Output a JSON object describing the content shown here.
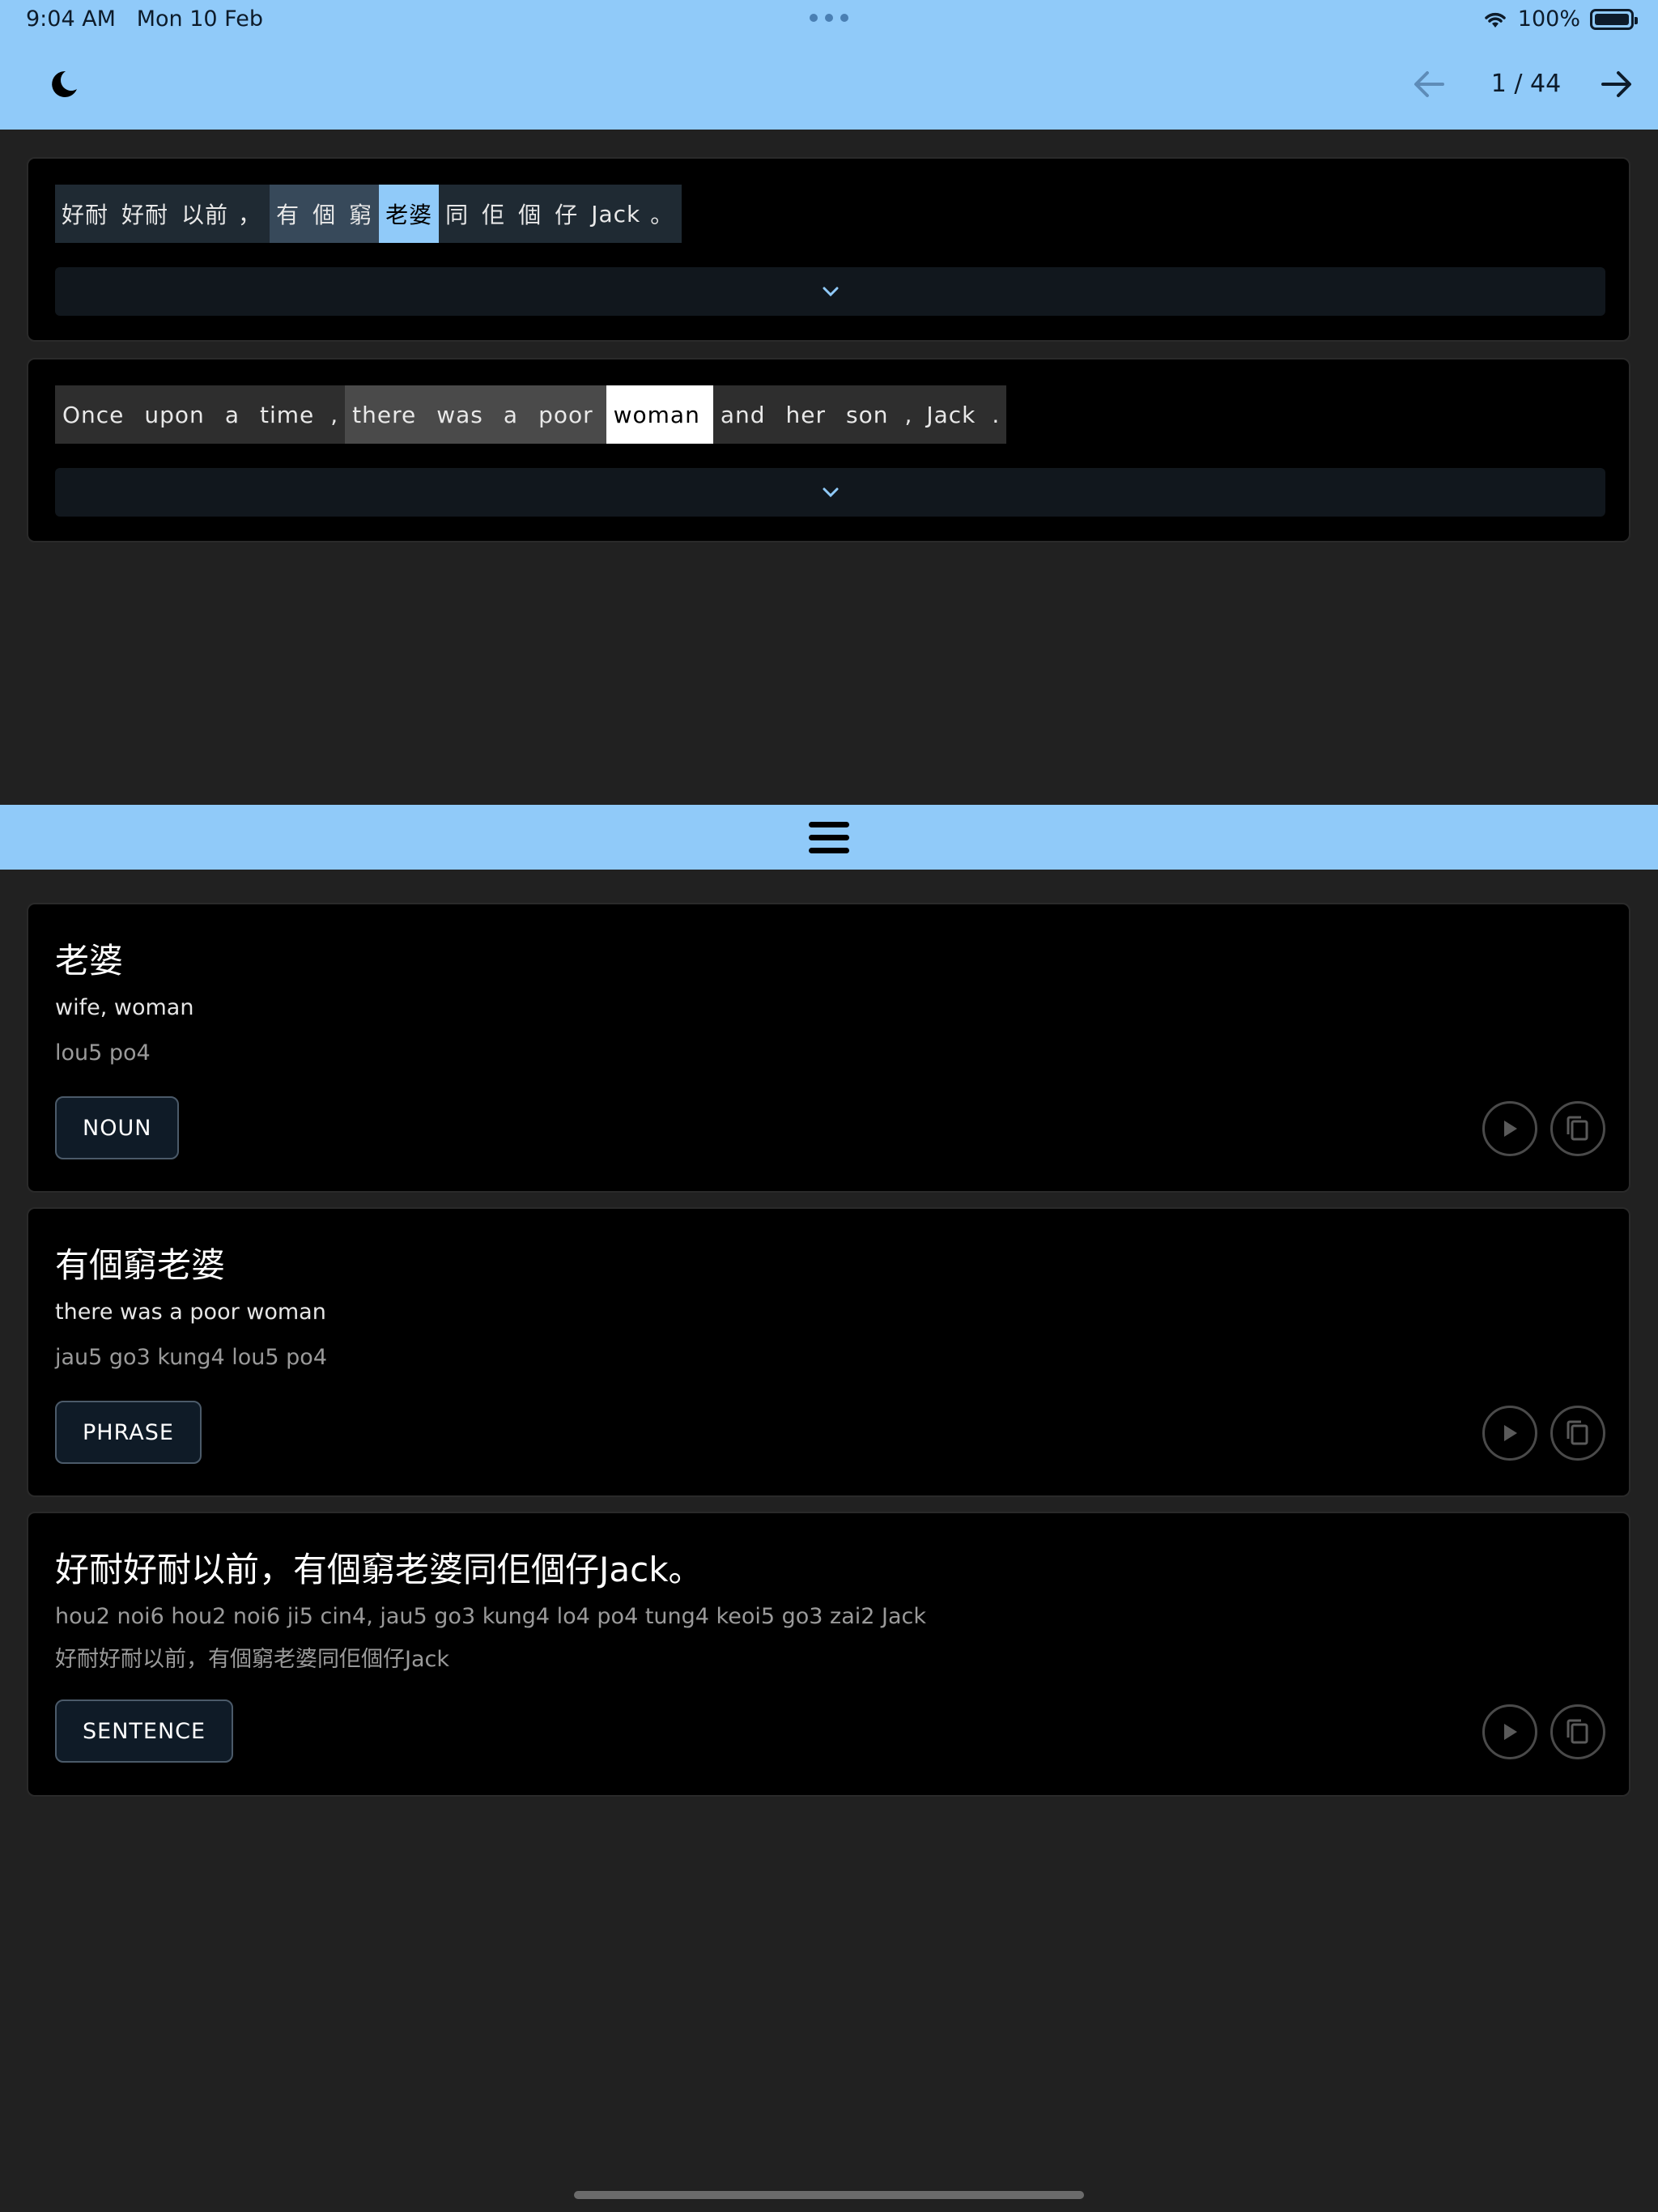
{
  "status_bar": {
    "time": "9:04 AM",
    "date": "Mon 10 Feb",
    "battery": "100%"
  },
  "app_bar": {
    "theme_icon": "moon-icon",
    "page_counter": "1 / 44",
    "prev_icon": "arrow-left-icon",
    "next_icon": "arrow-right-icon"
  },
  "chinese_sentence": {
    "tokens": [
      {
        "text": "好耐",
        "state": "group"
      },
      {
        "text": "好耐",
        "state": "group"
      },
      {
        "text": "以前",
        "state": "group"
      },
      {
        "text": "，",
        "state": "group"
      },
      {
        "text": "有",
        "state": "phrase"
      },
      {
        "text": "個",
        "state": "phrase"
      },
      {
        "text": "窮",
        "state": "phrase"
      },
      {
        "text": "老婆",
        "state": "selected"
      },
      {
        "text": "同",
        "state": "group"
      },
      {
        "text": "佢",
        "state": "group"
      },
      {
        "text": "個",
        "state": "group"
      },
      {
        "text": "仔",
        "state": "group"
      },
      {
        "text": "Jack",
        "state": "group"
      },
      {
        "text": "。",
        "state": "group"
      }
    ]
  },
  "english_sentence": {
    "tokens": [
      {
        "text": "Once",
        "state": "group"
      },
      {
        "text": "upon",
        "state": "group"
      },
      {
        "text": "a",
        "state": "group"
      },
      {
        "text": "time",
        "state": "group"
      },
      {
        "text": ",",
        "state": "group"
      },
      {
        "text": "there",
        "state": "phrase"
      },
      {
        "text": "was",
        "state": "phrase"
      },
      {
        "text": "a",
        "state": "phrase"
      },
      {
        "text": "poor",
        "state": "phrase"
      },
      {
        "text": "woman",
        "state": "selected"
      },
      {
        "text": "and",
        "state": "group"
      },
      {
        "text": "her",
        "state": "group"
      },
      {
        "text": "son",
        "state": "group"
      },
      {
        "text": ",",
        "state": "group"
      },
      {
        "text": "Jack",
        "state": "group"
      },
      {
        "text": ".",
        "state": "group"
      }
    ]
  },
  "expand_icon": "chevron-down-icon",
  "menu_icon": "hamburger-menu-icon",
  "details": [
    {
      "title": "老婆",
      "meaning": "wife, woman",
      "romanization": "lou5 po4",
      "tag": "NOUN"
    },
    {
      "title": "有個窮老婆",
      "meaning": "there was a poor woman",
      "romanization": "jau5 go3 kung4 lou5 po4",
      "tag": "PHRASE"
    },
    {
      "title": "好耐好耐以前，有個窮老婆同佢個仔Jack。",
      "romanization": "hou2 noi6 hou2 noi6 ji5 cin4, jau5 go3 kung4 lo4 po4 tung4 keoi5 go3 zai2 Jack",
      "meaning": "好耐好耐以前，有個窮老婆同佢個仔Jack",
      "tag": "SENTENCE"
    }
  ],
  "colors": {
    "accent": "#90caf9",
    "background": "#212121",
    "card": "#000000",
    "token_group": "#1f2a33",
    "token_phrase": "#37495a",
    "token_selected_cn": "#90caf9",
    "token_group_en": "#2e2e2e",
    "token_phrase_en": "#4a4a4a",
    "token_selected_en": "#ffffff"
  }
}
